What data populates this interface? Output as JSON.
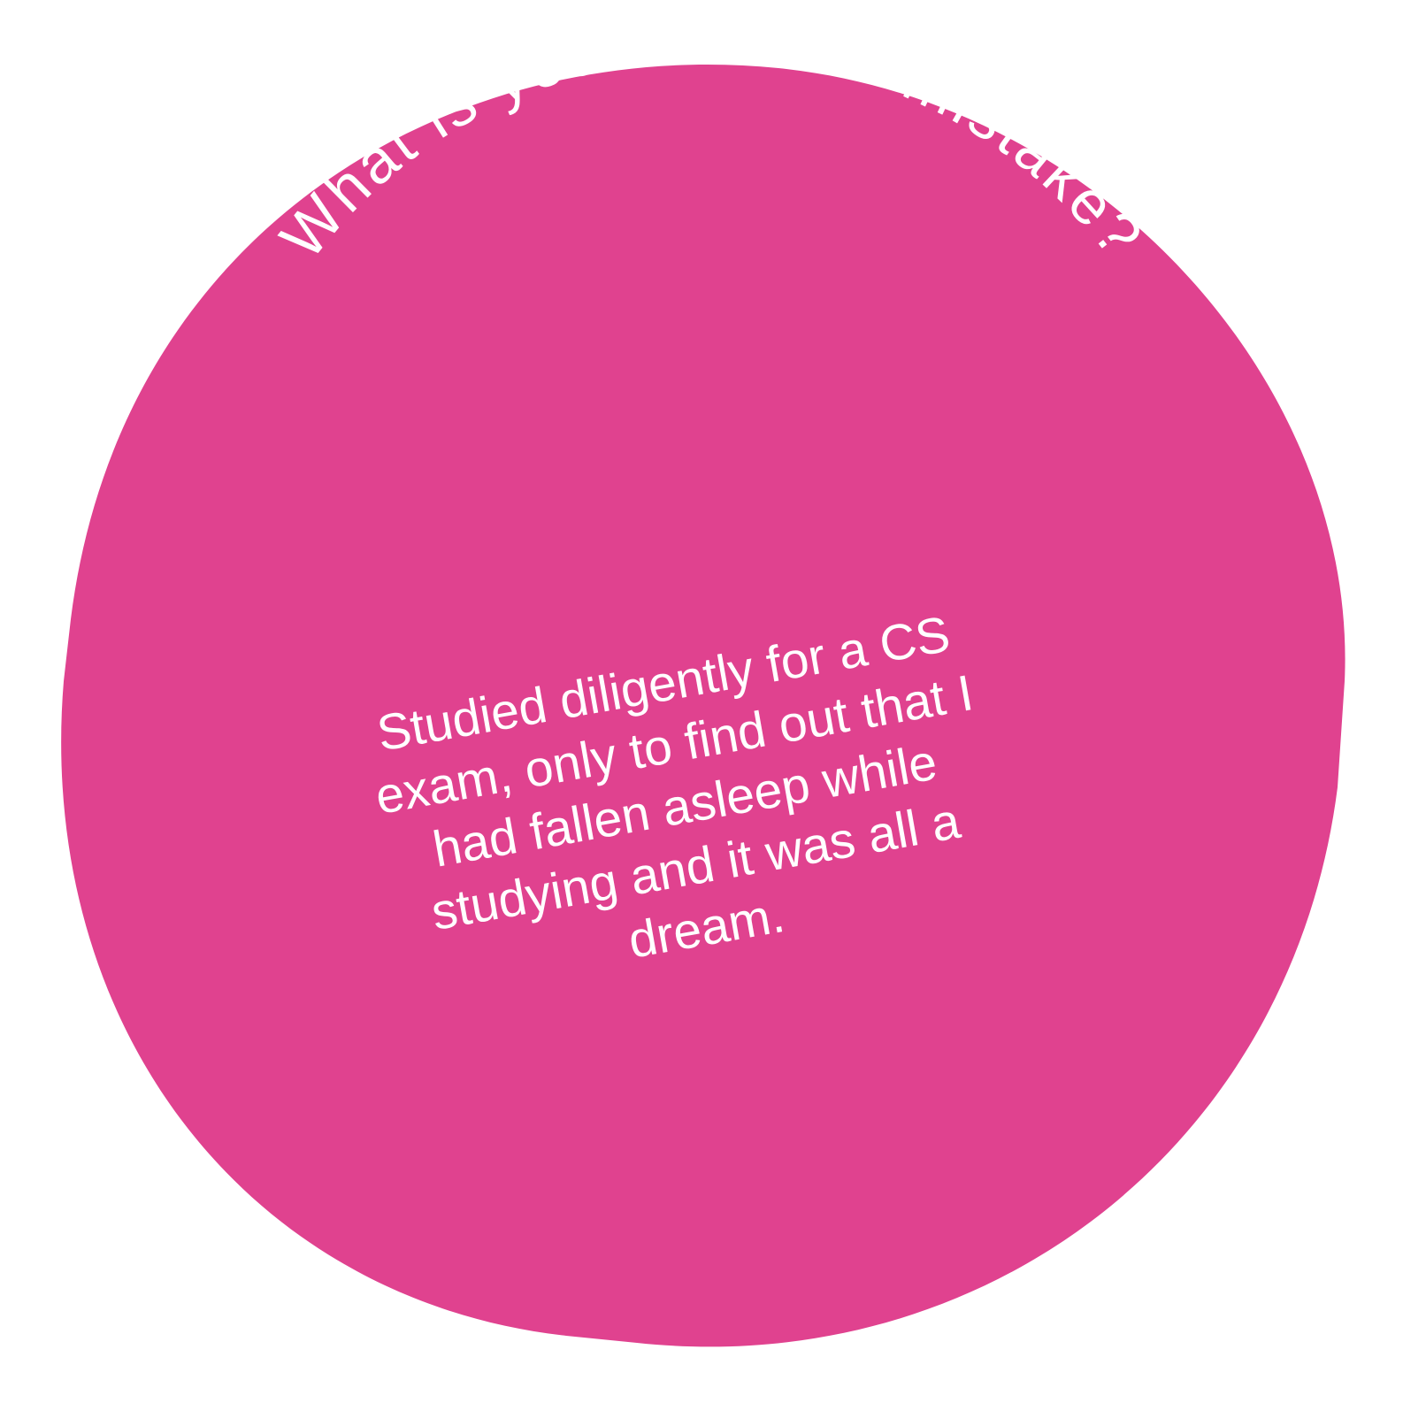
{
  "card": {
    "fill_color": "#e0428f",
    "text_color": "#ffffff",
    "question": "What is your favorite mistake?",
    "answer_lines": [
      "Studied diligently for a CS",
      "exam, only to find out that I",
      "had fallen asleep while",
      "studying and it was all a",
      "dream."
    ]
  }
}
